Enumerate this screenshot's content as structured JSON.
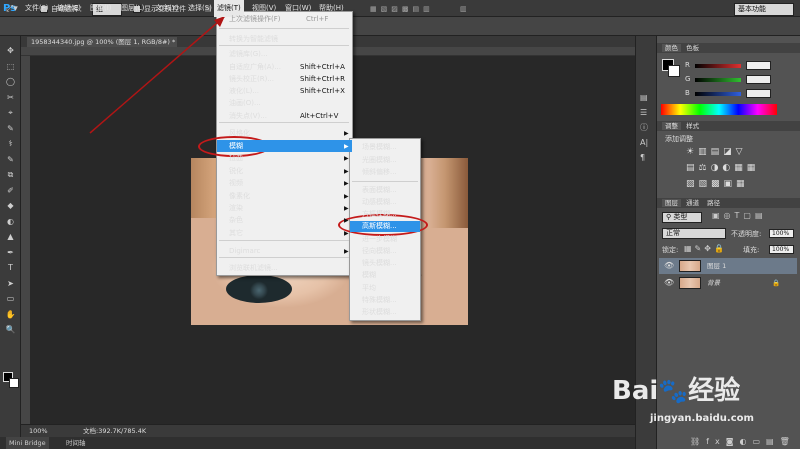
{
  "menubar": {
    "logo": "Ps",
    "items": [
      "文件(F)",
      "编辑(E)",
      "图像(I)",
      "图层(L)",
      "文字(Y)",
      "选择(S)",
      "滤镜(T)",
      "视图(V)",
      "窗口(W)",
      "帮助(H)"
    ],
    "active_index": 6
  },
  "options": {
    "auto_select": "自动选择：",
    "group_value": "组",
    "show_transform": "显示变换控件",
    "workspace": "基本功能"
  },
  "document": {
    "tab_title": "1958344340.jpg @ 100% (图层 1, RGB/8#) *",
    "zoom": "100%",
    "doc_info": "文档:392.7K/785.4K"
  },
  "bottom_tabs": [
    "Mini Bridge",
    "时间轴"
  ],
  "filter_menu": {
    "items": [
      {
        "label": "上次滤镜操作(F)",
        "shortcut": "Ctrl+F",
        "disabled": true
      },
      {
        "label": "转换为智能滤镜"
      },
      {
        "label": "滤镜库(G)..."
      },
      {
        "label": "自适应广角(A)...",
        "shortcut": "Shift+Ctrl+A"
      },
      {
        "label": "镜头校正(R)...",
        "shortcut": "Shift+Ctrl+R"
      },
      {
        "label": "液化(L)...",
        "shortcut": "Shift+Ctrl+X"
      },
      {
        "label": "油画(O)..."
      },
      {
        "label": "消失点(V)...",
        "shortcut": "Alt+Ctrl+V"
      },
      {
        "label": "风格化",
        "sub": true
      },
      {
        "label": "模糊",
        "sub": true,
        "highlighted": true
      },
      {
        "label": "扭曲",
        "sub": true
      },
      {
        "label": "锐化",
        "sub": true
      },
      {
        "label": "视频",
        "sub": true
      },
      {
        "label": "像素化",
        "sub": true
      },
      {
        "label": "渲染",
        "sub": true
      },
      {
        "label": "杂色",
        "sub": true
      },
      {
        "label": "其它",
        "sub": true
      },
      {
        "label": "Digimarc",
        "sub": true
      },
      {
        "label": "浏览联机滤镜..."
      }
    ]
  },
  "blur_submenu": {
    "items": [
      {
        "label": "场景模糊..."
      },
      {
        "label": "光圈模糊..."
      },
      {
        "label": "倾斜偏移..."
      },
      {
        "label": "表面模糊..."
      },
      {
        "label": "动感模糊..."
      },
      {
        "label": "方框模糊..."
      },
      {
        "label": "高斯模糊...",
        "highlighted": true
      },
      {
        "label": "进一步模糊"
      },
      {
        "label": "径向模糊..."
      },
      {
        "label": "镜头模糊..."
      },
      {
        "label": "模糊"
      },
      {
        "label": "平均"
      },
      {
        "label": "特殊模糊..."
      },
      {
        "label": "形状模糊..."
      }
    ]
  },
  "color_panel": {
    "tabs": [
      "颜色",
      "色板"
    ],
    "channels": [
      {
        "label": "R",
        "value": "",
        "color": "#e03030"
      },
      {
        "label": "G",
        "value": "",
        "color": "#30c030"
      },
      {
        "label": "B",
        "value": "",
        "color": "#3060e0"
      }
    ]
  },
  "adjust_panel": {
    "tabs": [
      "调整",
      "样式"
    ],
    "title": "添加调整"
  },
  "layers_panel": {
    "tabs": [
      "图层",
      "通道",
      "路径"
    ],
    "filter_kind": "类型",
    "blend_mode": "正常",
    "opacity_label": "不透明度:",
    "opacity_value": "100%",
    "lock_label": "锁定:",
    "fill_label": "填充:",
    "fill_value": "100%",
    "layers": [
      {
        "name": "图层 1",
        "selected": true
      },
      {
        "name": "背景",
        "locked": true
      }
    ]
  },
  "watermark": {
    "brand_left": "Bai",
    "brand_right": "经验",
    "url": "jingyan.baidu.com"
  }
}
